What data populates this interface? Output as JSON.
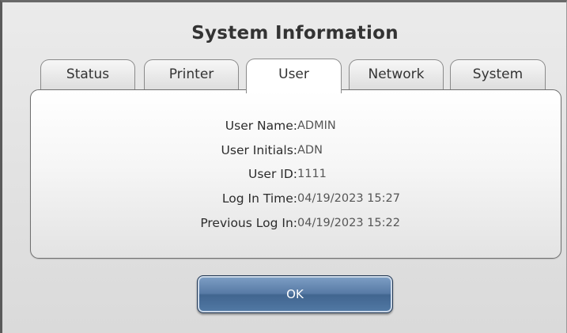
{
  "dialog": {
    "title": "System Information"
  },
  "tabs": [
    {
      "label": "Status",
      "active": false
    },
    {
      "label": "Printer",
      "active": false
    },
    {
      "label": "User",
      "active": true
    },
    {
      "label": "Network",
      "active": false
    },
    {
      "label": "System",
      "active": false
    }
  ],
  "user_info": {
    "rows": [
      {
        "label": "User Name:",
        "value": "ADMIN"
      },
      {
        "label": "User Initials:",
        "value": "ADN"
      },
      {
        "label": "User ID:",
        "value": "1111"
      },
      {
        "label": "Log In Time:",
        "value": "04/19/2023 15:27"
      },
      {
        "label": "Previous Log In:",
        "value": "04/19/2023 15:22"
      }
    ]
  },
  "buttons": {
    "ok_label": "OK"
  },
  "colors": {
    "button_blue": "#577aa5",
    "dialog_background": "#e4e4e4",
    "panel_border": "#6f6f6f"
  }
}
